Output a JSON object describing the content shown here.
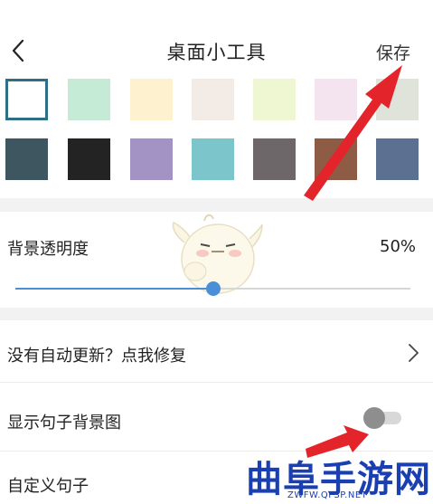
{
  "header": {
    "back_icon": "chevron-left-icon",
    "title": "桌面小工具",
    "save_label": "保存"
  },
  "swatches": [
    {
      "color": "#ffffff",
      "selected": true
    },
    {
      "color": "#c5ead6",
      "selected": false
    },
    {
      "color": "#fdf1cf",
      "selected": false
    },
    {
      "color": "#f3ebe6",
      "selected": false
    },
    {
      "color": "#eff7d2",
      "selected": false
    },
    {
      "color": "#f4e4ef",
      "selected": false
    },
    {
      "color": "#dfe3da",
      "selected": false
    },
    {
      "color": "#3e5660",
      "selected": false
    },
    {
      "color": "#232323",
      "selected": false
    },
    {
      "color": "#a393c4",
      "selected": false
    },
    {
      "color": "#7cc6cb",
      "selected": false
    },
    {
      "color": "#6d6769",
      "selected": false
    },
    {
      "color": "#8e5c45",
      "selected": false
    },
    {
      "color": "#5c7192",
      "selected": false
    }
  ],
  "opacity": {
    "label": "背景透明度",
    "value_text": "50%",
    "value": 0.5
  },
  "rows": {
    "repair_label": "没有自动更新？点我修复",
    "show_bg_label": "显示句子背景图",
    "show_bg_on": false,
    "custom_label": "自定义句子"
  },
  "watermark": {
    "text": "曲阜手游网",
    "url": "ZWFW.QFSP.NET"
  },
  "colors": {
    "accent": "#4a90d9",
    "arrow": "#e3242b",
    "watermark": "#1a3fb3"
  }
}
